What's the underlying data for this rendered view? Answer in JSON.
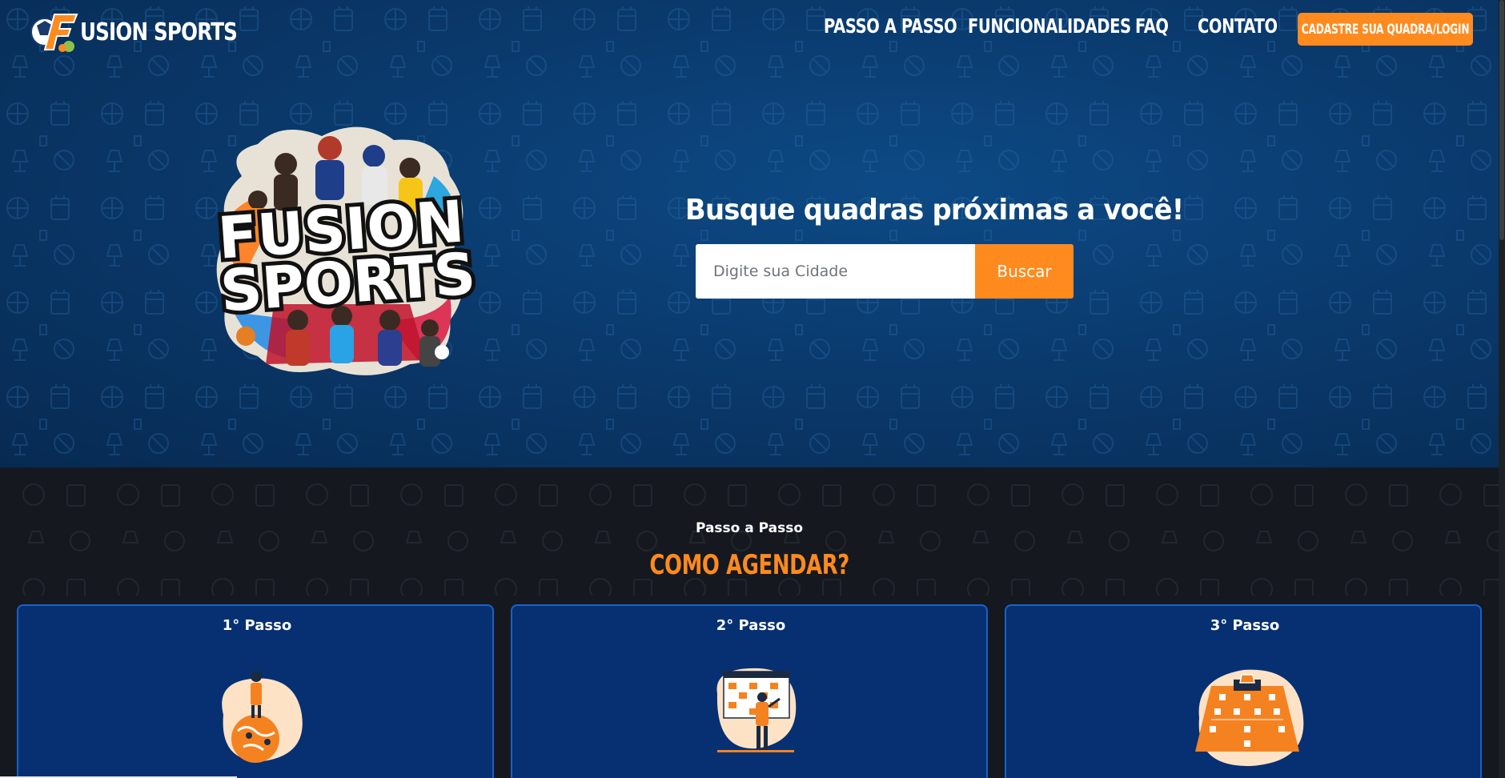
{
  "brand": {
    "name": "USION SPORTS",
    "logo_letter": "F",
    "primary_color": "#ff8a1e",
    "navy_color": "#0a3a6d",
    "card_color": "#063072"
  },
  "nav": {
    "links": [
      "PASSO A PASSO",
      "FUNCIONALIDADES",
      "FAQ",
      "CONTATO"
    ],
    "cta_label": "CADASTRE SUA QUADRA/LOGIN"
  },
  "hero": {
    "poster_line1": "FUSION",
    "poster_line2": "SPORTS",
    "search_title": "Busque quadras próximas a você!",
    "search_placeholder": "Digite sua Cidade",
    "search_button": "Buscar"
  },
  "steps": {
    "kicker": "Passo a Passo",
    "title": "COMO AGENDAR?",
    "cards": [
      {
        "title": "1° Passo",
        "icon": "globe-location-icon"
      },
      {
        "title": "2° Passo",
        "icon": "calendar-schedule-icon"
      },
      {
        "title": "3° Passo",
        "icon": "soccer-field-lineup-icon"
      }
    ]
  }
}
